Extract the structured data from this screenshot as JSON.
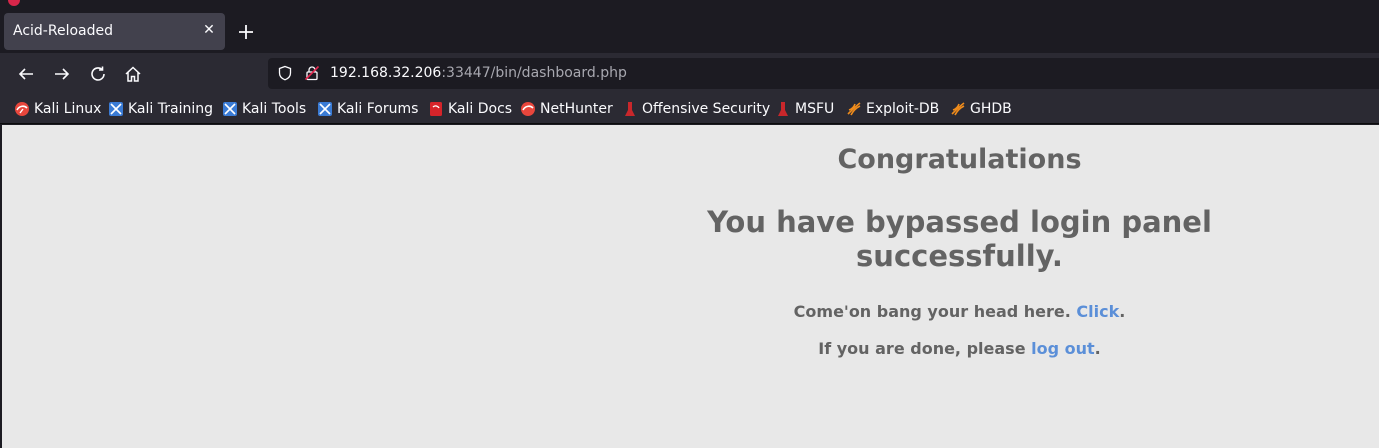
{
  "browser": {
    "tab": {
      "title": "Acid-Reloaded",
      "close_icon": "close-icon"
    },
    "new_tab_icon": "plus-icon",
    "nav": {
      "back_icon": "arrow-left-icon",
      "forward_icon": "arrow-right-icon",
      "reload_icon": "reload-icon",
      "home_icon": "home-icon"
    },
    "url": {
      "host": "192.168.32.206",
      "rest": ":33447/bin/dashboard.php"
    },
    "bookmarks": [
      {
        "label": "Kali Linux",
        "icon": "kali-logo-icon"
      },
      {
        "label": "Kali Training",
        "icon": "kali-training-icon"
      },
      {
        "label": "Kali Tools",
        "icon": "kali-tools-icon"
      },
      {
        "label": "Kali Forums",
        "icon": "kali-forums-icon"
      },
      {
        "label": "Kali Docs",
        "icon": "kali-docs-icon"
      },
      {
        "label": "NetHunter",
        "icon": "nethunter-icon"
      },
      {
        "label": "Offensive Security",
        "icon": "offsec-icon"
      },
      {
        "label": "MSFU",
        "icon": "msfu-icon"
      },
      {
        "label": "Exploit-DB",
        "icon": "exploit-db-icon"
      },
      {
        "label": "GHDB",
        "icon": "ghdb-icon"
      }
    ]
  },
  "page": {
    "heading": "Congratulations",
    "subheading": "You have bypassed login panel successfully.",
    "line1": {
      "text": "Come'on bang your head here. ",
      "link": "Click",
      "suffix": "."
    },
    "line2": {
      "text": "If you are done, please ",
      "link": "log out",
      "suffix": "."
    }
  },
  "colors": {
    "tab_bg": "#42414d",
    "toolbar_bg": "#2b2a33",
    "page_bg": "#e8e8e8",
    "heading_text": "#636363",
    "link": "#5b8fd8"
  }
}
